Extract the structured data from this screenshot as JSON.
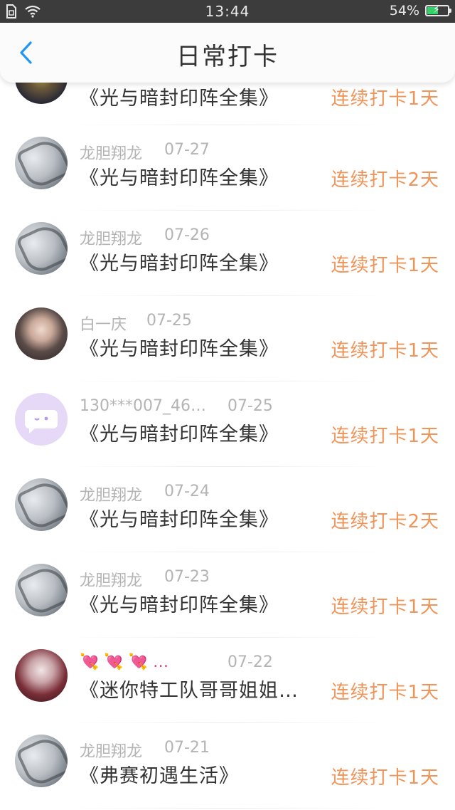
{
  "status_bar": {
    "time": "13:44",
    "battery": "54%",
    "battery_level": 0.54
  },
  "header": {
    "title": "日常打卡",
    "back_icon": "chevron-left-icon"
  },
  "colors": {
    "accent": "#f0955a",
    "back": "#2196f3"
  },
  "checkins": [
    {
      "user": "",
      "date": "",
      "book": "《光与暗封印阵全集》",
      "streak": "连续打卡1天",
      "avatar": "av-dark"
    },
    {
      "user": "龙胆翔龙",
      "date": "07-27",
      "book": "《光与暗封印阵全集》",
      "streak": "连续打卡2天",
      "avatar": "av-gray"
    },
    {
      "user": "龙胆翔龙",
      "date": "07-26",
      "book": "《光与暗封印阵全集》",
      "streak": "连续打卡1天",
      "avatar": "av-gray"
    },
    {
      "user": "白一庆",
      "date": "07-25",
      "book": "《光与暗封印阵全集》",
      "streak": "连续打卡1天",
      "avatar": "av-girl"
    },
    {
      "user": "130***007_46…",
      "date": "07-25",
      "book": "《光与暗封印阵全集》",
      "streak": "连续打卡1天",
      "avatar": "av-purple"
    },
    {
      "user": "龙胆翔龙",
      "date": "07-24",
      "book": "《光与暗封印阵全集》",
      "streak": "连续打卡2天",
      "avatar": "av-gray"
    },
    {
      "user": "龙胆翔龙",
      "date": "07-23",
      "book": "《光与暗封印阵全集》",
      "streak": "连续打卡1天",
      "avatar": "av-gray"
    },
    {
      "user": "💘 💘 💘 …",
      "date": "07-22",
      "book": "《迷你特工队哥哥姐姐…",
      "streak": "连续打卡1天",
      "avatar": "av-red"
    },
    {
      "user": "龙胆翔龙",
      "date": "07-21",
      "book": "《弗赛初遇生活》",
      "streak": "连续打卡1天",
      "avatar": "av-gray"
    }
  ]
}
